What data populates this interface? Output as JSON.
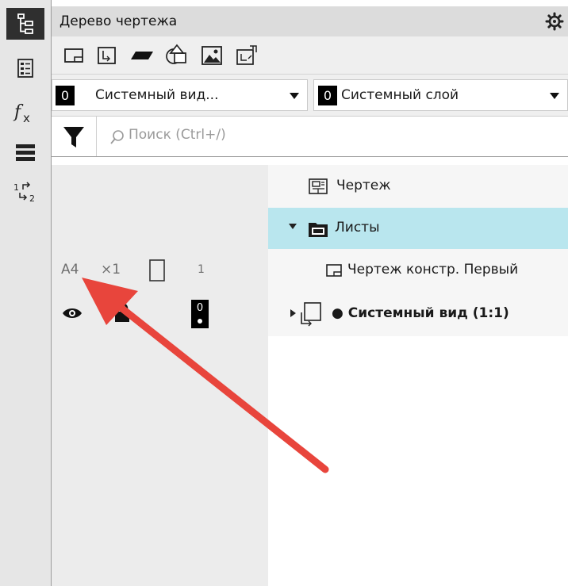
{
  "panel": {
    "title": "Дерево чертежа"
  },
  "selectors": {
    "view": {
      "number": "0",
      "label": "Системный вид..."
    },
    "layer": {
      "number": "0",
      "label": "Системный слой"
    }
  },
  "search": {
    "placeholder": "Поиск (Ctrl+/)"
  },
  "tree": {
    "drawing": "Чертеж",
    "sheets": "Листы",
    "sheet_item": {
      "format": "А4",
      "multiplier": "×1",
      "count": "1",
      "label": "Чертеж констр. Первый"
    },
    "view_item": {
      "layer_number": "0",
      "label": "● Системный вид (1:1)"
    }
  },
  "colors": {
    "selected_row": "#b9e6ee",
    "annotation_arrow": "#e8453c",
    "rail_active": "#2f2f2f"
  },
  "icons": {
    "rail": [
      "tree-icon",
      "properties-icon",
      "function-icon",
      "layers-icon",
      "swap-icon"
    ],
    "toolbar": [
      "sheet-icon",
      "view-icon",
      "parallelogram-icon",
      "shapes-icon",
      "image-icon",
      "fragment-icon"
    ]
  }
}
